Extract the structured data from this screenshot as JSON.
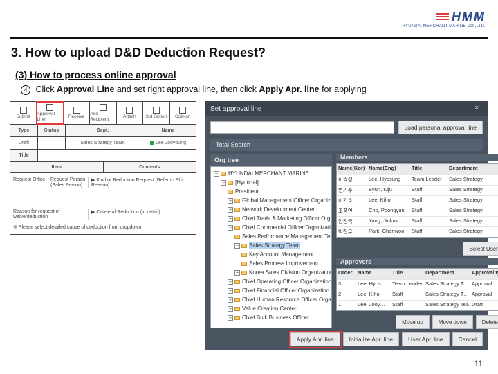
{
  "brand": {
    "name": "HMM",
    "tagline": "HYUNDAI MERCHANT MARINE CO.,LTD."
  },
  "doc": {
    "title": "3. How to upload D&D Deduction Request?",
    "subtitle": "(3) How to process online approval",
    "step_num": "4",
    "step_a": "Click ",
    "step_b": "Approval Line",
    "step_c": " and set right approval line, then click ",
    "step_d": "Apply Apr. line",
    "step_e": " for applying",
    "pagenum": "11"
  },
  "toolbar": {
    "items": [
      "Submit",
      "Approval Line",
      "Receive",
      "Add Recipient",
      "Attach",
      "Std Option",
      "Opinion"
    ]
  },
  "grid_headers": {
    "type": "Type",
    "status": "Status",
    "dept": "Dept.",
    "name": "Name",
    "title": "Title",
    "item": "Item",
    "contents": "Contents"
  },
  "grid_row": {
    "type": "Draft",
    "status": "",
    "dept": "Sales Strategy Team",
    "name": "Lee Jooyoung"
  },
  "form": {
    "req_office_lab": "Request Office",
    "req_person_lab": "Request Person (Sales Person)",
    "kind_lab": "▶ Kind of Reduction Request (Refer to Phi Reason)",
    "reason_lab": "Reason for request of waive/deduction",
    "reason_val": "▶ Cause of Reduction  (in detail)",
    "note": "※ Please select detailed cause of deduction from dropdown"
  },
  "modal": {
    "title": "Set approval line",
    "search_placeholder": "",
    "btn_load": "Load personal approval line",
    "total_search": "Total Search",
    "org_tree": "Org tree",
    "members": "Members",
    "approvers": "Approvers",
    "btn_select_user": "Select User",
    "btn_moveup": "Move up",
    "btn_movedown": "Move down",
    "btn_delete": "Delete",
    "btn_apply": "Apply Apr. line",
    "btn_init": "Initialize Apr. line",
    "btn_user": "User Apr. line",
    "btn_cancel": "Cancel",
    "member_cols": [
      "Name(Kor)",
      "Name(Eng)",
      "Title",
      "Department"
    ],
    "members_rows": [
      {
        "kor": "이효성",
        "eng": "Lee, Hyosung",
        "title": "Team Leader",
        "dept": "Sales Strategy"
      },
      {
        "kor": "변기주",
        "eng": "Byun, Kiju",
        "title": "Staff",
        "dept": "Sales Strategy"
      },
      {
        "kor": "이기호",
        "eng": "Lee, Kiho",
        "title": "Staff",
        "dept": "Sales Strategy"
      },
      {
        "kor": "조풍연",
        "eng": "Cho, Poongyun",
        "title": "Staff",
        "dept": "Sales Strategy"
      },
      {
        "kor": "양진국",
        "eng": "Yang, Jinkuk",
        "title": "Staff",
        "dept": "Sales Strategy"
      },
      {
        "kor": "박찬우",
        "eng": "Park, Chanwoo",
        "title": "Staff",
        "dept": "Sales Strategy"
      }
    ],
    "approver_cols": [
      "Order",
      "Name",
      "Title",
      "Department",
      "Approval type"
    ],
    "approvers_rows": [
      {
        "order": "3",
        "name": "Lee, Hyos…",
        "title": "Team Leader",
        "dept": "Sales Strategy T…",
        "type": "Approval"
      },
      {
        "order": "2",
        "name": "Lee, Kiho",
        "title": "Staff",
        "dept": "Sales Strategy T…",
        "type": "Approval"
      },
      {
        "order": "1",
        "name": "Lee, Jooy…",
        "title": "Staff",
        "dept": "Sales Strategy Tea",
        "type": "Draft"
      }
    ],
    "tree": {
      "root": "HYUNDAI MERCHANT MARINE",
      "n0": "[Hyundai]",
      "n1": "President",
      "n2": "Global Management Officer Organization",
      "n3": "Network Development Center",
      "n4": "Chief Trade & Marketing Officer Organization",
      "n5": "Chief Commercial Officer Organization",
      "n5a": "Sales Performance Management Team",
      "n5b": "Sales Strategy Team",
      "n5b1": "Key Account Management",
      "n5b2": "Sales Process Improvement",
      "n5c": "Korea Sales Division Organization",
      "n6": "Chief Operating Officer Organization",
      "n7": "Chief Financial Officer Organization",
      "n8": "Chief Human Resource Officer Organization",
      "n9": "Value Creation Center",
      "n10": "Chief Bulk Business Officer"
    }
  }
}
